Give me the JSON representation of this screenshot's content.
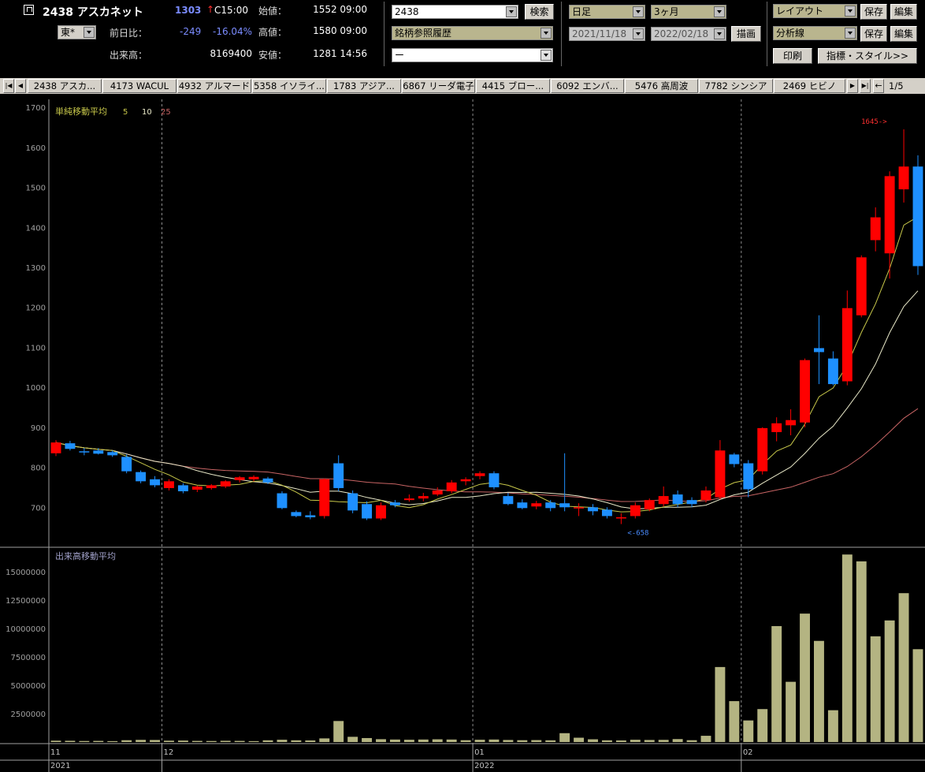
{
  "header": {
    "stock_title": "2438 アスカネット",
    "price": "1303",
    "price_arrow": "↑",
    "close_time": "C15:00",
    "market_select": "東*",
    "change_label": "前日比：",
    "change_value": "-249",
    "change_percent": "-16.04%",
    "volume_label": "出来高：",
    "volume_value": "8169400",
    "open_label": "始値：",
    "open_value": "1552 09:00",
    "high_label": "高値：",
    "high_value": "1580 09:00",
    "low_label": "安値：",
    "low_value": "1281 14:56",
    "code_input": "2438",
    "search_button": "検索",
    "history_select": "銘柄参照履歴",
    "empty_select": "ー",
    "period_type": "日足",
    "period_range": "3ヶ月",
    "date_from": "2021/11/18",
    "date_to": "2022/02/18",
    "draw_button": "描画",
    "layout_select": "レイアウト",
    "analysis_select": "分析線",
    "save_label": "保存",
    "edit_label": "編集",
    "print_button": "印刷",
    "style_button": "指標・スタイル>>"
  },
  "tabs": [
    "2438 アスカ...",
    "4173 WACUL",
    "4932 アルマード",
    "5358 イソライ...",
    "1783 アジア...",
    "6867 リーダ電子",
    "4415 ブロー...",
    "6092 エンバ...",
    "5476 高周波",
    "7782 シンシア",
    "2469 ヒビノ"
  ],
  "page_indicator": "1/5",
  "colors": {
    "up": "#ff0000",
    "down": "#1e90ff",
    "ma5": "#c8c84a",
    "ma10": "#e8e8c8",
    "ma25": "#c86464",
    "volume": "#b4b482",
    "axis": "#a0a0a0"
  },
  "chart_data": {
    "type": "candlestick",
    "price_title": "単純移動平均",
    "ma_periods": [
      "5",
      "10",
      "25"
    ],
    "volume_title": "出来高移動平均",
    "price_ticks": [
      "1700",
      "1600",
      "1500",
      "1400",
      "1300",
      "1200",
      "1100",
      "1000",
      "900",
      "800",
      "700"
    ],
    "volume_ticks": [
      "15000000",
      "12500000",
      "10000000",
      "7500000",
      "5000000",
      "2500000"
    ],
    "ylim_price": [
      600,
      1720
    ],
    "ylim_volume": [
      0,
      17000000
    ],
    "x_labels": [
      {
        "index": 0,
        "month": "11",
        "year": "2021"
      },
      {
        "index": 8,
        "month": "12",
        "year": ""
      },
      {
        "index": 30,
        "month": "01",
        "year": "2022"
      },
      {
        "index": 49,
        "month": "02",
        "year": ""
      }
    ],
    "annotations": [
      {
        "index": 59,
        "price": 1645,
        "text": "1645->",
        "kind": "high"
      },
      {
        "index": 40,
        "price": 658,
        "text": "<-658",
        "kind": "low"
      }
    ],
    "candles": [
      {
        "o": 835,
        "h": 868,
        "l": 828,
        "c": 862,
        "v": 120000
      },
      {
        "o": 860,
        "h": 866,
        "l": 842,
        "c": 846,
        "v": 110000
      },
      {
        "o": 840,
        "h": 848,
        "l": 830,
        "c": 838,
        "v": 90000
      },
      {
        "o": 842,
        "h": 848,
        "l": 832,
        "c": 834,
        "v": 100000
      },
      {
        "o": 838,
        "h": 842,
        "l": 826,
        "c": 830,
        "v": 80000
      },
      {
        "o": 826,
        "h": 832,
        "l": 785,
        "c": 790,
        "v": 160000
      },
      {
        "o": 788,
        "h": 792,
        "l": 760,
        "c": 765,
        "v": 190000
      },
      {
        "o": 770,
        "h": 778,
        "l": 750,
        "c": 755,
        "v": 180000
      },
      {
        "o": 748,
        "h": 770,
        "l": 742,
        "c": 765,
        "v": 120000
      },
      {
        "o": 755,
        "h": 760,
        "l": 735,
        "c": 740,
        "v": 130000
      },
      {
        "o": 744,
        "h": 754,
        "l": 738,
        "c": 752,
        "v": 100000
      },
      {
        "o": 748,
        "h": 758,
        "l": 744,
        "c": 755,
        "v": 90000
      },
      {
        "o": 752,
        "h": 768,
        "l": 748,
        "c": 765,
        "v": 110000
      },
      {
        "o": 768,
        "h": 778,
        "l": 762,
        "c": 775,
        "v": 100000
      },
      {
        "o": 770,
        "h": 780,
        "l": 765,
        "c": 776,
        "v": 80000
      },
      {
        "o": 772,
        "h": 776,
        "l": 758,
        "c": 762,
        "v": 150000
      },
      {
        "o": 735,
        "h": 740,
        "l": 695,
        "c": 698,
        "v": 200000
      },
      {
        "o": 688,
        "h": 692,
        "l": 675,
        "c": 678,
        "v": 150000
      },
      {
        "o": 680,
        "h": 690,
        "l": 670,
        "c": 675,
        "v": 140000
      },
      {
        "o": 678,
        "h": 772,
        "l": 672,
        "c": 770,
        "v": 320000
      },
      {
        "o": 810,
        "h": 830,
        "l": 740,
        "c": 748,
        "v": 1850000
      },
      {
        "o": 735,
        "h": 742,
        "l": 685,
        "c": 692,
        "v": 460000
      },
      {
        "o": 708,
        "h": 715,
        "l": 668,
        "c": 672,
        "v": 350000
      },
      {
        "o": 672,
        "h": 712,
        "l": 668,
        "c": 705,
        "v": 250000
      },
      {
        "o": 712,
        "h": 718,
        "l": 700,
        "c": 705,
        "v": 220000
      },
      {
        "o": 718,
        "h": 732,
        "l": 714,
        "c": 722,
        "v": 200000
      },
      {
        "o": 722,
        "h": 736,
        "l": 715,
        "c": 728,
        "v": 220000
      },
      {
        "o": 732,
        "h": 750,
        "l": 728,
        "c": 742,
        "v": 240000
      },
      {
        "o": 740,
        "h": 768,
        "l": 735,
        "c": 762,
        "v": 220000
      },
      {
        "o": 765,
        "h": 775,
        "l": 755,
        "c": 770,
        "v": 160000
      },
      {
        "o": 778,
        "h": 790,
        "l": 770,
        "c": 785,
        "v": 200000
      },
      {
        "o": 785,
        "h": 790,
        "l": 745,
        "c": 750,
        "v": 220000
      },
      {
        "o": 728,
        "h": 736,
        "l": 705,
        "c": 708,
        "v": 180000
      },
      {
        "o": 712,
        "h": 720,
        "l": 695,
        "c": 698,
        "v": 160000
      },
      {
        "o": 702,
        "h": 716,
        "l": 695,
        "c": 710,
        "v": 170000
      },
      {
        "o": 712,
        "h": 718,
        "l": 690,
        "c": 698,
        "v": 150000
      },
      {
        "o": 710,
        "h": 835,
        "l": 690,
        "c": 700,
        "v": 780000
      },
      {
        "o": 698,
        "h": 710,
        "l": 678,
        "c": 700,
        "v": 380000
      },
      {
        "o": 700,
        "h": 708,
        "l": 680,
        "c": 690,
        "v": 240000
      },
      {
        "o": 694,
        "h": 700,
        "l": 672,
        "c": 678,
        "v": 150000
      },
      {
        "o": 672,
        "h": 685,
        "l": 658,
        "c": 675,
        "v": 140000
      },
      {
        "o": 678,
        "h": 712,
        "l": 672,
        "c": 705,
        "v": 200000
      },
      {
        "o": 695,
        "h": 722,
        "l": 690,
        "c": 718,
        "v": 180000
      },
      {
        "o": 708,
        "h": 752,
        "l": 702,
        "c": 728,
        "v": 190000
      },
      {
        "o": 732,
        "h": 742,
        "l": 700,
        "c": 708,
        "v": 260000
      },
      {
        "o": 718,
        "h": 725,
        "l": 700,
        "c": 708,
        "v": 160000
      },
      {
        "o": 718,
        "h": 752,
        "l": 712,
        "c": 742,
        "v": 550000
      },
      {
        "o": 725,
        "h": 868,
        "l": 720,
        "c": 842,
        "v": 6600000
      },
      {
        "o": 832,
        "h": 836,
        "l": 800,
        "c": 808,
        "v": 3600000
      },
      {
        "o": 810,
        "h": 818,
        "l": 725,
        "c": 745,
        "v": 1900000
      },
      {
        "o": 790,
        "h": 900,
        "l": 782,
        "c": 898,
        "v": 2900000
      },
      {
        "o": 888,
        "h": 925,
        "l": 865,
        "c": 910,
        "v": 10200000
      },
      {
        "o": 905,
        "h": 945,
        "l": 880,
        "c": 918,
        "v": 5300000
      },
      {
        "o": 912,
        "h": 1072,
        "l": 900,
        "c": 1068,
        "v": 11300000
      },
      {
        "o": 1098,
        "h": 1180,
        "l": 1008,
        "c": 1088,
        "v": 8900000
      },
      {
        "o": 1072,
        "h": 1090,
        "l": 1005,
        "c": 1008,
        "v": 2800000
      },
      {
        "o": 1015,
        "h": 1242,
        "l": 1005,
        "c": 1198,
        "v": 16500000
      },
      {
        "o": 1180,
        "h": 1330,
        "l": 1175,
        "c": 1325,
        "v": 15900000
      },
      {
        "o": 1368,
        "h": 1450,
        "l": 1340,
        "c": 1425,
        "v": 9300000
      },
      {
        "o": 1335,
        "h": 1540,
        "l": 1272,
        "c": 1528,
        "v": 10700000
      },
      {
        "o": 1495,
        "h": 1645,
        "l": 1462,
        "c": 1552,
        "v": 13100000
      },
      {
        "o": 1552,
        "h": 1580,
        "l": 1281,
        "c": 1303,
        "v": 8169400
      }
    ]
  }
}
